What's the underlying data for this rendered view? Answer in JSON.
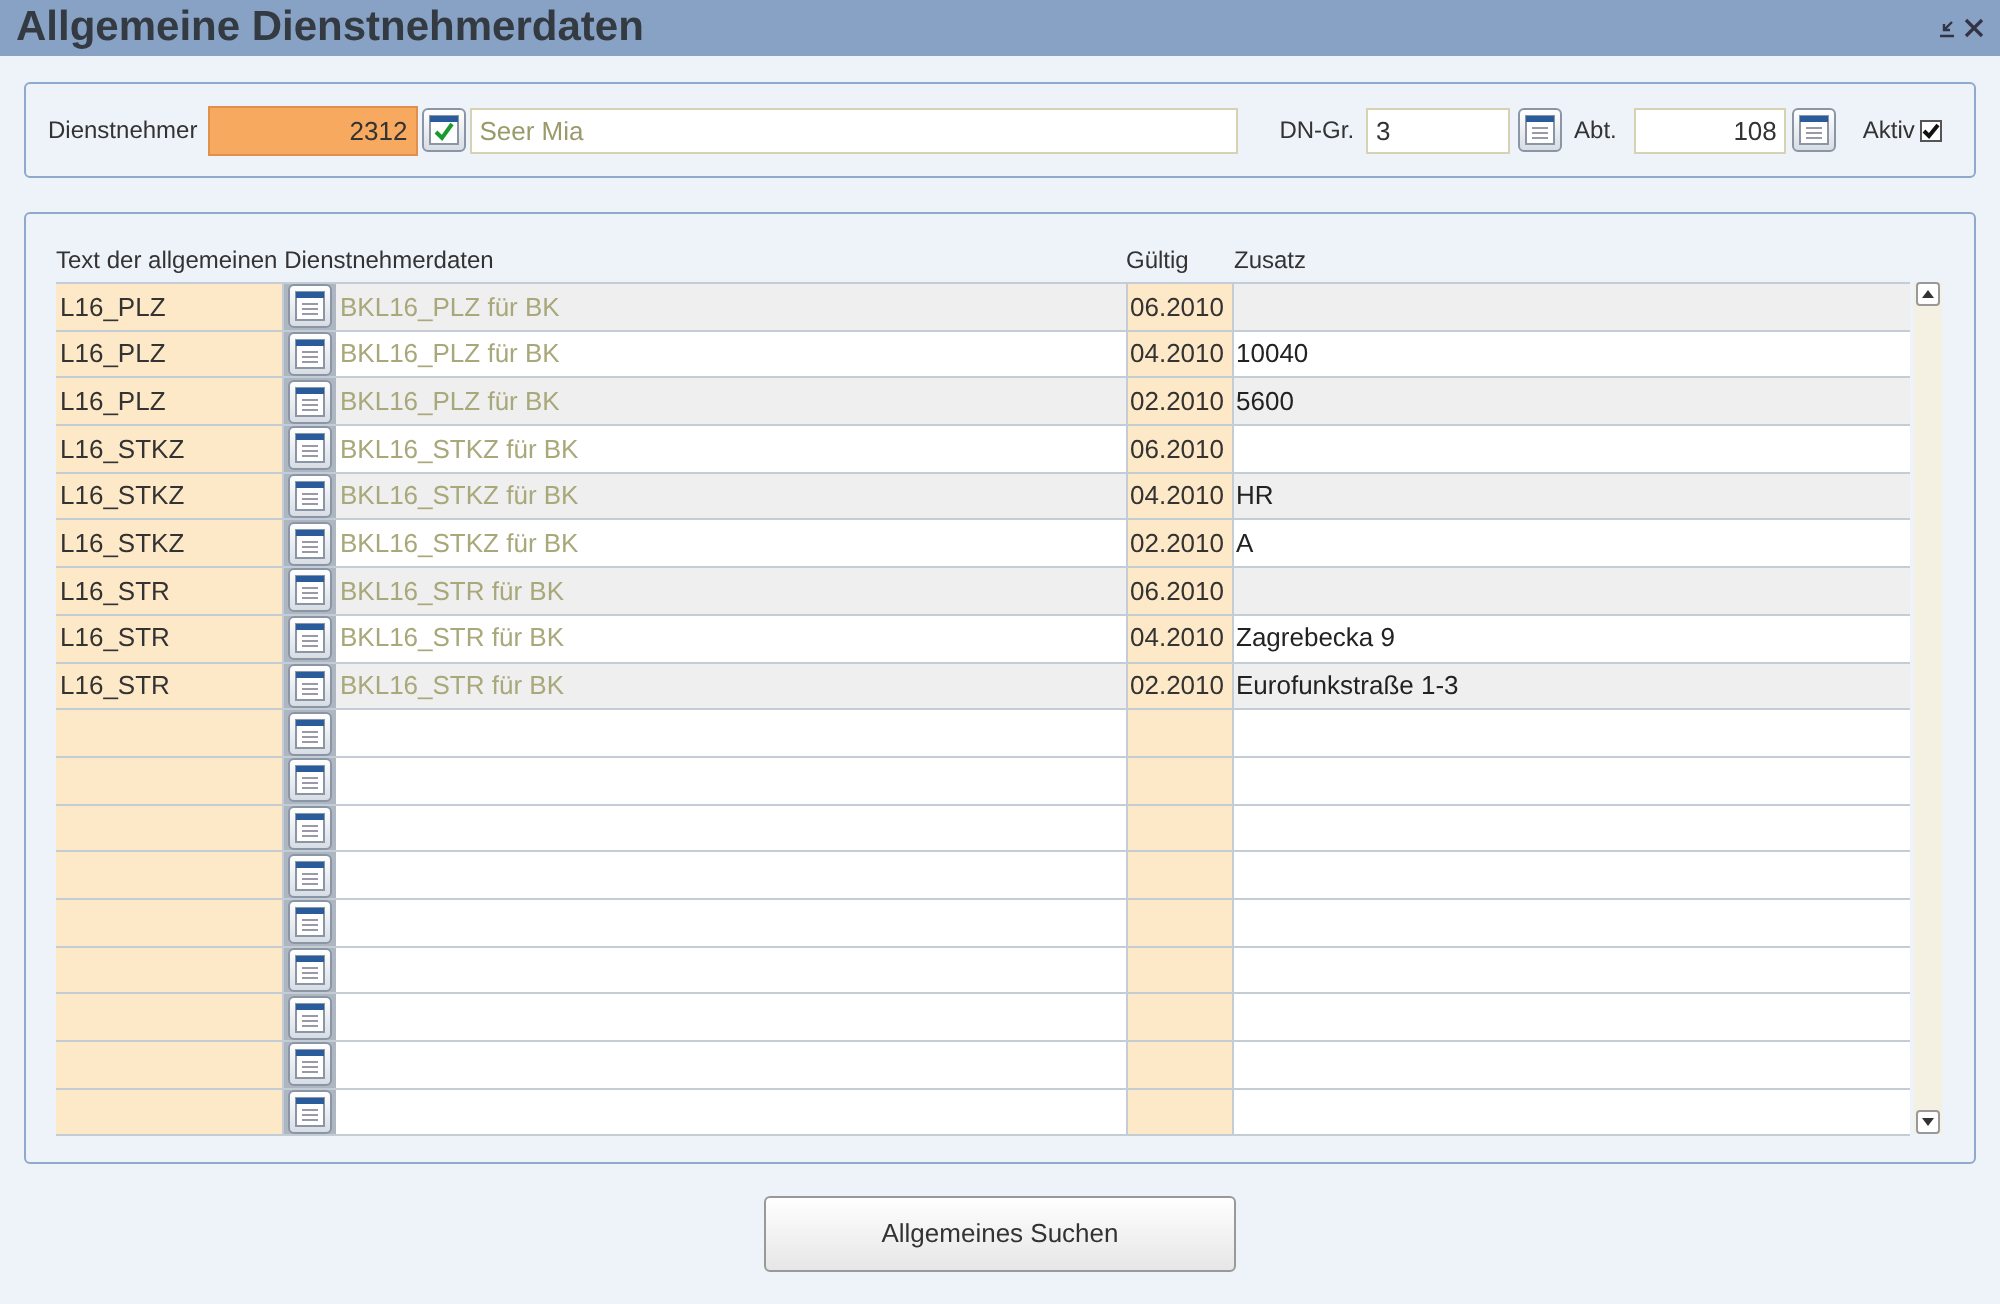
{
  "window": {
    "title": "Allgemeine Dienstnehmerdaten"
  },
  "header": {
    "employee_label": "Dienstnehmer",
    "employee_number": "2312",
    "employee_name": "Seer Mia",
    "group_label": "DN-Gr.",
    "group_value": "3",
    "dept_label": "Abt.",
    "dept_value": "108",
    "active_label": "Aktiv",
    "active_checked": true
  },
  "table": {
    "columns": [
      "Text der allgemeinen Dienstnehmerdaten",
      "Gültig",
      "Zusatz"
    ],
    "rows": [
      {
        "code": "L16_PLZ",
        "text": "BKL16_PLZ für BK",
        "valid": "06.2010"
      },
      {
        "code": "L16_PLZ",
        "text": "BKL16_PLZ für BK",
        "valid": "04.2010",
        "extra": "10040"
      },
      {
        "code": "L16_PLZ",
        "text": "BKL16_PLZ für BK",
        "valid": "02.2010",
        "extra": "5600"
      },
      {
        "code": "L16_STKZ",
        "text": "BKL16_STKZ für BK",
        "valid": "06.2010"
      },
      {
        "code": "L16_STKZ",
        "text": "BKL16_STKZ für BK",
        "valid": "04.2010",
        "extra": "HR"
      },
      {
        "code": "L16_STKZ",
        "text": "BKL16_STKZ für BK",
        "valid": "02.2010",
        "extra": "A"
      },
      {
        "code": "L16_STR",
        "text": "BKL16_STR für BK",
        "valid": "06.2010"
      },
      {
        "code": "L16_STR",
        "text": "BKL16_STR für BK",
        "valid": "04.2010",
        "extra": "Zagrebecka 9"
      },
      {
        "code": "L16_STR",
        "text": "BKL16_STR für BK",
        "valid": "02.2010",
        "extra": "Eurofunkstraße 1-3"
      },
      {},
      {},
      {},
      {},
      {},
      {},
      {},
      {},
      {}
    ]
  },
  "search_button": "Allgemeines Suchen"
}
